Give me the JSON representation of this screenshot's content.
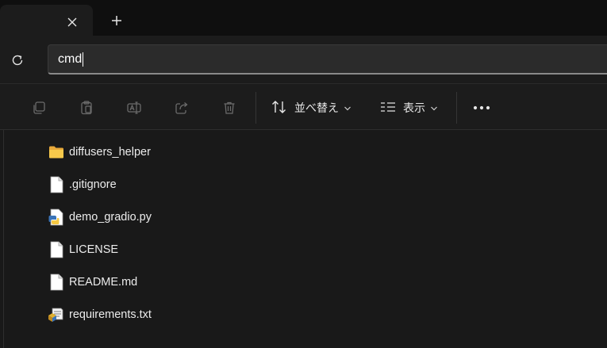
{
  "address_bar": {
    "value": "cmd"
  },
  "toolbar": {
    "sort_label": "並べ替え",
    "view_label": "表示"
  },
  "files": [
    {
      "name": "diffusers_helper",
      "icon": "folder-icon"
    },
    {
      "name": ".gitignore",
      "icon": "file-icon"
    },
    {
      "name": "demo_gradio.py",
      "icon": "python-file-icon"
    },
    {
      "name": "LICENSE",
      "icon": "file-icon"
    },
    {
      "name": "README.md",
      "icon": "file-icon"
    },
    {
      "name": "requirements.txt",
      "icon": "text-config-file-icon"
    }
  ],
  "colors": {
    "background": "#191919",
    "toolbar": "#1c1c1c",
    "folder": "#f5c542",
    "text": "#ececec"
  }
}
